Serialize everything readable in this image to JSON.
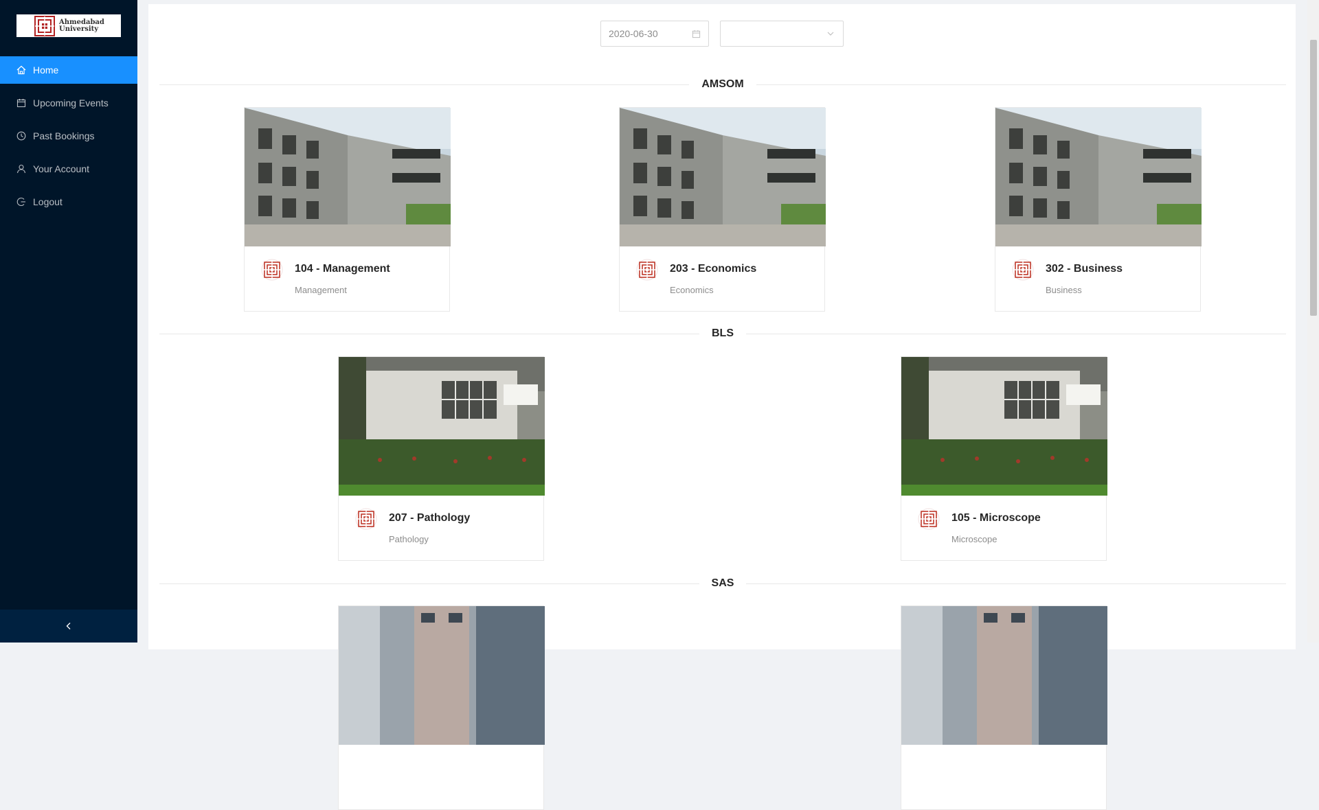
{
  "brand": {
    "line1": "Ahmedabad",
    "line2": "University"
  },
  "menu": [
    {
      "label": "Home",
      "icon": "home-icon",
      "active": true
    },
    {
      "label": "Upcoming Events",
      "icon": "calendar-icon",
      "active": false
    },
    {
      "label": "Past Bookings",
      "icon": "clock-icon",
      "active": false
    },
    {
      "label": "Your Account",
      "icon": "user-icon",
      "active": false
    },
    {
      "label": "Logout",
      "icon": "logout-icon",
      "active": false
    }
  ],
  "collapse": {
    "icon": "chevron-left-icon"
  },
  "filters": {
    "date": "2020-06-30",
    "select_value": ""
  },
  "sections": [
    {
      "name": "AMSOM",
      "rooms": [
        {
          "title": "104 - Management",
          "desc": "Management"
        },
        {
          "title": "203 - Economics",
          "desc": "Economics"
        },
        {
          "title": "302 - Business",
          "desc": "Business"
        }
      ]
    },
    {
      "name": "BLS",
      "rooms": [
        {
          "title": "207 - Pathology",
          "desc": "Pathology"
        },
        {
          "title": "105 - Microscope",
          "desc": "Microscope"
        }
      ]
    },
    {
      "name": "SAS",
      "rooms": [
        {
          "title": "",
          "desc": ""
        },
        {
          "title": "",
          "desc": ""
        }
      ]
    }
  ],
  "colors": {
    "sidebar": "#001529",
    "accent": "#1890ff",
    "brand_red": "#c0392b"
  }
}
